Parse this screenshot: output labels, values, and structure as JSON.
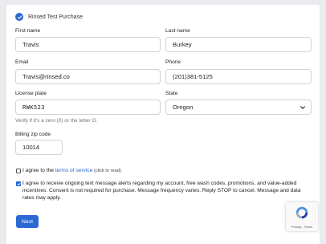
{
  "header": {
    "title": "Rinsed Test Purchase"
  },
  "fields": {
    "first_name": {
      "label": "First name",
      "value": "Travis"
    },
    "last_name": {
      "label": "Last name",
      "value": "Burkey"
    },
    "email": {
      "label": "Email",
      "value": "Travis@rinsed.co"
    },
    "phone": {
      "label": "Phone",
      "value": "(201)381-5125"
    },
    "license_plate": {
      "label": "License plate",
      "value": "RWK523",
      "helper": "Verify if it's a zero (0) or the letter O."
    },
    "state": {
      "label": "State",
      "value": "Oregon"
    },
    "billing_zip": {
      "label": "Billing zip code",
      "value": "10014"
    }
  },
  "terms": {
    "prefix": "I agree to the ",
    "link": "terms of service",
    "suffix": "(click to read)."
  },
  "sms_consent": {
    "text": "I agree to receive ongoing text message alerts regarding my account, free wash codes, promotions, and value-added incentives. Consent is not required for purchase. Message frequency varies. Reply STOP to cancel. Message and data rates may apply."
  },
  "buttons": {
    "next": "Next"
  },
  "recaptcha": {
    "privacy": "Privacy",
    "separator": " - ",
    "terms": "Terms"
  },
  "colors": {
    "accent": "#2c67d4",
    "background": "#e9ebee",
    "card": "#ffffff"
  }
}
